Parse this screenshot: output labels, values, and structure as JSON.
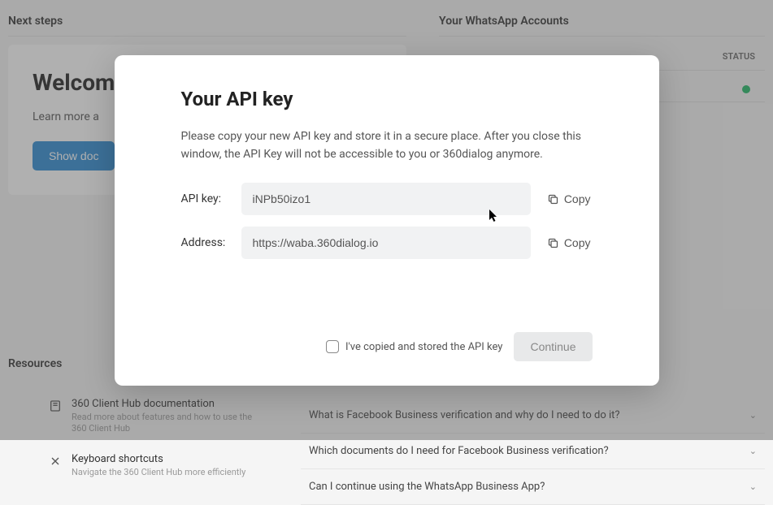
{
  "bg": {
    "next_steps_title": "Next steps",
    "accounts_title": "Your WhatsApp Accounts",
    "status_header": "STATUS",
    "welcome_title": "Welcom",
    "welcome_sub": "Learn more a",
    "show_btn": "Show doc",
    "resources_title": "Resources",
    "res_items": [
      {
        "title": "360 Client Hub documentation",
        "sub": "Read more about features and how to use the 360 Client Hub"
      },
      {
        "title": "Keyboard shortcuts",
        "sub": "Navigate the 360 Client Hub more efficiently"
      }
    ],
    "faq": [
      "What is Facebook Business verification and why do I need to do it?",
      "Which documents do I need for Facebook Business verification?",
      "Can I continue using the WhatsApp Business App?"
    ]
  },
  "modal": {
    "title": "Your API key",
    "desc": "Please copy your new API key and store it in a secure place. After you close this window, the API Key will not be accessible to you or 360dialog anymore.",
    "api_label": "API key:",
    "api_value": "iNPb50izo1",
    "addr_label": "Address:",
    "addr_value": "https://waba.360dialog.io",
    "copy_label": "Copy",
    "confirm_label": "I've copied and stored the API key",
    "continue_label": "Continue"
  }
}
